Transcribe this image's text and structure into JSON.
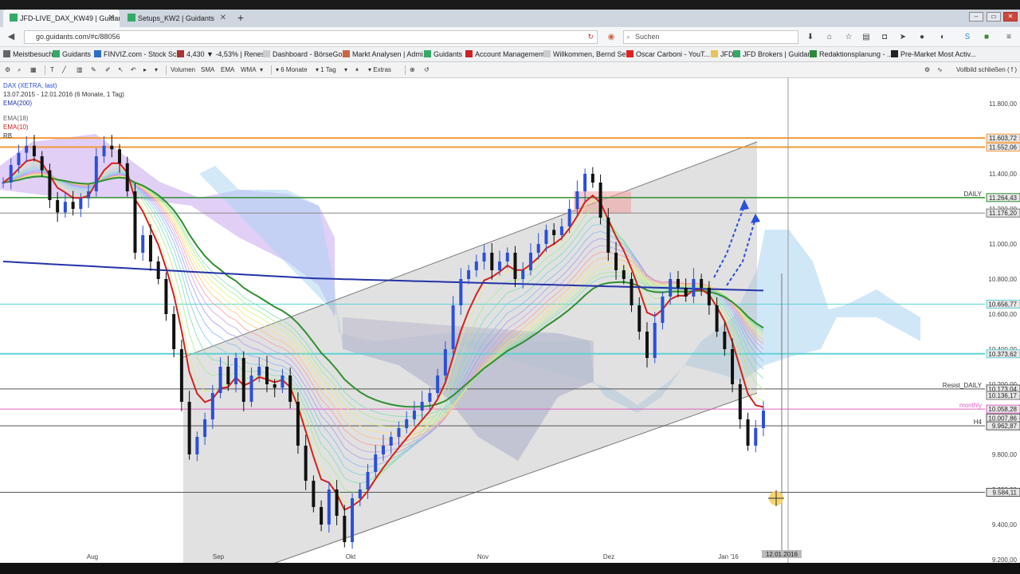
{
  "browser": {
    "tabs": [
      {
        "title": "JFD-LIVE_DAX_KW49 | Guidants",
        "active": true
      },
      {
        "title": "Setups_KW2 | Guidants",
        "active": false
      }
    ],
    "url": "go.guidants.com/#c/88056",
    "search_placeholder": "Suchen"
  },
  "bookmarks": [
    {
      "label": "Meistbesucht",
      "icon": "gear-icon",
      "color": "#666"
    },
    {
      "label": "Guidants",
      "icon": "gd-icon",
      "color": "#3a6"
    },
    {
      "label": "FINVIZ.com - Stock Sc...",
      "icon": "finviz-icon",
      "color": "#2a6fc4"
    },
    {
      "label": "4,430 ▼ -4,53% | Renes...",
      "icon": "bear-icon",
      "color": "#a33"
    },
    {
      "label": "Dashboard - BörseGo ...",
      "icon": "blank-icon",
      "color": "#ccc"
    },
    {
      "label": "Markt Analysen | Admi...",
      "icon": "chart-icon",
      "color": "#c64"
    },
    {
      "label": "Guidants",
      "icon": "gd-icon",
      "color": "#3a6"
    },
    {
      "label": "Account Management",
      "icon": "jfd-icon",
      "color": "#c22"
    },
    {
      "label": "Willkommen, Bernd Se...",
      "icon": "blank-icon",
      "color": "#ccc"
    },
    {
      "label": "Oscar Carboni - YouT...",
      "icon": "youtube-icon",
      "color": "#d22"
    },
    {
      "label": "JFD",
      "icon": "folder-icon",
      "color": "#e8c25a"
    },
    {
      "label": "JFD Brokers | Guidants",
      "icon": "gd-icon",
      "color": "#3a6"
    },
    {
      "label": "Redaktionsplanung - ...",
      "icon": "sheet-icon",
      "color": "#2a8a3a"
    },
    {
      "label": "Pre-Market Most Activ...",
      "icon": "market-icon",
      "color": "#222"
    }
  ],
  "chart_toolbar": {
    "volume": "Volumen",
    "sma": "SMA",
    "ema": "EMA",
    "wma": "WMA",
    "period": "6 Monate",
    "interval": "1 Tag",
    "extras": "Extras",
    "fullscreen": "Vollbild schließen ( f )"
  },
  "chart_data": {
    "type": "candlestick",
    "instrument": "DAX (XETRA, last)",
    "range_text": "13.07.2015 - 12.01.2016 (6 Monate, 1 Tag)",
    "indicators": [
      "EMA(200)",
      "EMA(18)",
      "EMA(10)",
      "RB"
    ],
    "x_ticks": [
      "Aug",
      "Sep",
      "Okt",
      "Nov",
      "Dez",
      "Jan '16"
    ],
    "y_ticks": [
      11800,
      11600,
      11400,
      11200,
      11000,
      10800,
      10600,
      10400,
      10200,
      10000,
      9800,
      9600,
      9400,
      9200
    ],
    "y_tick_labels": [
      "11.800,00",
      "11.600,00",
      "11.400,00",
      "11.200,00",
      "11.000,00",
      "10.800,00",
      "10.600,00",
      "10.400,00",
      "10.200,00",
      "10.000,00",
      "9.800,00",
      "9.600,00",
      "9.400,00",
      "9.200,00"
    ],
    "ylim": [
      9200,
      11800
    ],
    "price_labels": [
      {
        "text": "11.603,72",
        "value": 11603.72,
        "color": "#f29a3a"
      },
      {
        "text": "11.552,06",
        "value": 11552.06,
        "color": "#f29a3a"
      },
      {
        "text": "11.264,43",
        "value": 11264.43,
        "color": "#2f8f2f"
      },
      {
        "text": "11.176,20",
        "value": 11176.2,
        "color": "#777"
      },
      {
        "text": "10.656,77",
        "value": 10656.77,
        "color": "#5fd3d3"
      },
      {
        "text": "10.373,62",
        "value": 10373.62,
        "color": "#5fd3d3"
      },
      {
        "text": "10.173,04",
        "value": 10173.04,
        "color": "#555"
      },
      {
        "text": "10.136,17",
        "value": 10136.17,
        "color": "#777"
      },
      {
        "text": "10.058,28",
        "value": 10058.28,
        "color": "#e060c0"
      },
      {
        "text": "10.007,86",
        "value": 10007.86,
        "color": "#555"
      },
      {
        "text": "9.962,87",
        "value": 9962.87,
        "color": "#555"
      },
      {
        "text": "9.584,11",
        "value": 9584.11,
        "color": "#555"
      }
    ],
    "line_labels": [
      {
        "text": "DAILY",
        "value": 11264.43
      },
      {
        "text": "Resist_DAILY",
        "value": 10173.04
      },
      {
        "text": "monthly",
        "value": 10058.28
      },
      {
        "text": "H4",
        "value": 9962.87
      }
    ],
    "crosshair_date": "12.01.2016",
    "series_close": [
      11350,
      11450,
      11520,
      11560,
      11500,
      11420,
      11250,
      11180,
      11240,
      11200,
      11260,
      11300,
      11500,
      11560,
      11540,
      11460,
      11300,
      10950,
      11050,
      10900,
      10800,
      10600,
      10400,
      10100,
      9800,
      9900,
      10000,
      10150,
      10300,
      10200,
      10350,
      10100,
      10250,
      10300,
      10200,
      10180,
      10250,
      10100,
      9850,
      9650,
      9500,
      9400,
      9600,
      9450,
      9300,
      9550,
      9600,
      9700,
      9800,
      9850,
      9900,
      9950,
      10000,
      10050,
      10100,
      10150,
      10250,
      10400,
      10650,
      10800,
      10850,
      10900,
      10950,
      10850,
      10900,
      10950,
      10800,
      10850,
      10950,
      11000,
      11080,
      11050,
      11100,
      11200,
      11300,
      11400,
      11350,
      11150,
      10950,
      10850,
      10800,
      10650,
      10500,
      10350,
      10550,
      10700,
      10800,
      10750,
      10700,
      10800,
      10750,
      10650,
      10500,
      10400,
      10200,
      10000,
      9850,
      9950,
      10050
    ]
  },
  "colors": {
    "bull": "#2b4fd8",
    "bear": "#111111",
    "orange_line": "#f29a3a",
    "green_line": "#2f8f2f",
    "cyan_line": "#5fd3d3",
    "ema200": "#2433a8",
    "ema_red": "#d42020",
    "arrow": "#2b4fd8"
  }
}
